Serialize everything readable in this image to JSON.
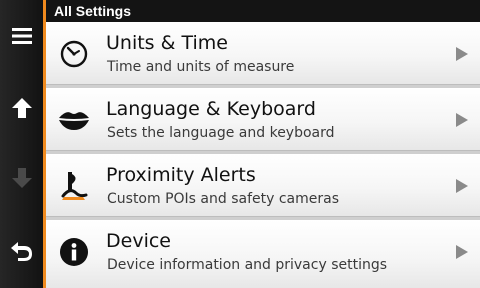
{
  "header": {
    "title": "All Settings"
  },
  "sidebar": {
    "buttons": [
      {
        "icon": "menu-icon"
      },
      {
        "icon": "arrow-up-icon"
      },
      {
        "icon": "arrow-down-icon",
        "disabled": true
      },
      {
        "icon": "back-icon"
      }
    ],
    "accent_color": "#f08a1e"
  },
  "settings": {
    "items": [
      {
        "title": "Units & Time",
        "subtitle": "Time and units of measure",
        "icon": "clock-icon"
      },
      {
        "title": "Language & Keyboard",
        "subtitle": "Sets the language and keyboard",
        "icon": "lips-icon"
      },
      {
        "title": "Proximity Alerts",
        "subtitle": "Custom POIs and safety cameras",
        "icon": "alert-pin-icon"
      },
      {
        "title": "Device",
        "subtitle": "Device information and privacy settings",
        "icon": "info-icon"
      }
    ]
  }
}
